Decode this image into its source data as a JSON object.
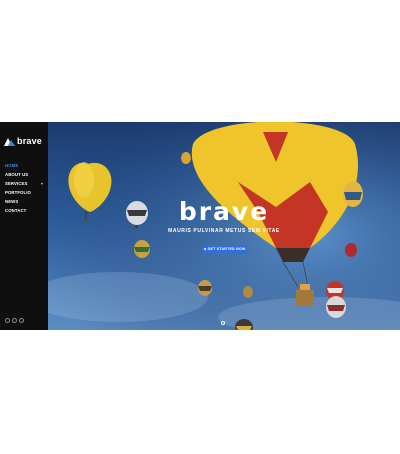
{
  "brand": {
    "name": "brave",
    "accent": "#3b82e8"
  },
  "nav": {
    "items": [
      {
        "label": "HOME",
        "active": true
      },
      {
        "label": "ABOUT US",
        "active": false
      },
      {
        "label": "SERVICES",
        "active": false,
        "has_submenu": true
      },
      {
        "label": "PORTFOLIO",
        "active": false
      },
      {
        "label": "NEWS",
        "active": false
      },
      {
        "label": "CONTACT",
        "active": false
      }
    ],
    "social_icons": [
      "facebook-icon",
      "twitter-icon",
      "instagram-icon"
    ]
  },
  "hero": {
    "title": "brave",
    "subtitle": "MAURIS PULVINAR METUS SEM VITAE",
    "cta_label": "GET STARTED NOW",
    "cta_color": "#2f6fde",
    "background": "hot air balloons in blue sky"
  }
}
